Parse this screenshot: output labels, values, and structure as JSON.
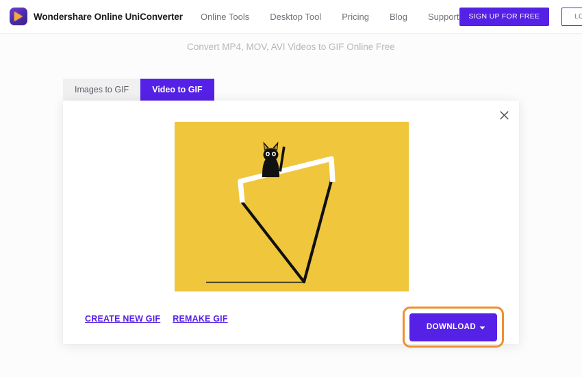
{
  "header": {
    "logo_icon": "wondershare-play-logo-icon",
    "brand_name": "Wondershare Online UniConverter",
    "nav_items": [
      {
        "label": "Online Tools"
      },
      {
        "label": "Desktop Tool"
      },
      {
        "label": "Pricing"
      },
      {
        "label": "Blog"
      },
      {
        "label": "Support"
      }
    ],
    "signup_label": "SIGN UP FOR FREE",
    "login_label": "LOG IN",
    "search_icon": "search-icon",
    "accent_color": "#5521e6",
    "nav_text_color": "#71717a"
  },
  "page": {
    "subtitle": "Convert MP4, MOV, AVI Videos to GIF Online Free",
    "background_color": "#fcfcfc"
  },
  "tabs": [
    {
      "label": "Images to GIF",
      "active": false
    },
    {
      "label": "Video to GIF",
      "active": true
    }
  ],
  "card": {
    "close_icon": "close-icon",
    "preview": {
      "alt": "animated gif preview: black cat balancing on an inverted triangle",
      "background_color": "#efc63c",
      "line_white_color": "#ffffff",
      "line_black_color": "#111111",
      "cat_color": "#111111"
    },
    "actions": {
      "create_new_label": "CREATE NEW GIF",
      "remake_label": "REMAKE GIF",
      "download_label": "DOWNLOAD",
      "download_caret_icon": "chevron-down-icon",
      "download_button_color": "#5521e6",
      "download_highlight_color": "#ef8f2f"
    }
  }
}
